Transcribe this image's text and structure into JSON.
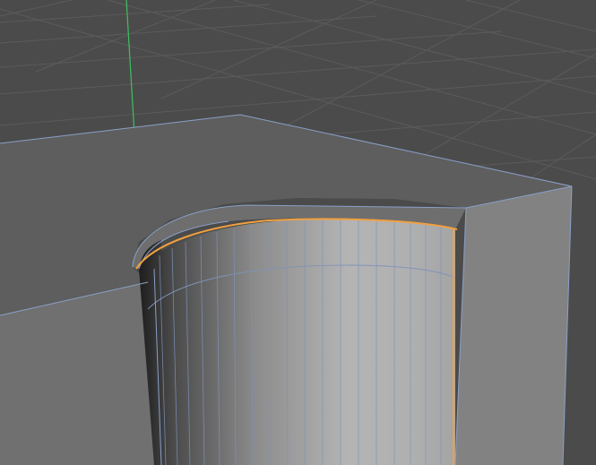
{
  "viewport": {
    "background_color": "#4b4b4b",
    "grid_color": "#5c5c5c",
    "axis_y_color": "#3fbf5f",
    "edge_color": "#8aa0c8",
    "selection_color": "#f0a040"
  },
  "objects": [
    {
      "name": "block",
      "type": "box-with-cylindrical-cutout"
    },
    {
      "name": "cylinder",
      "type": "cylinder",
      "selected_edge_loop": true
    }
  ]
}
